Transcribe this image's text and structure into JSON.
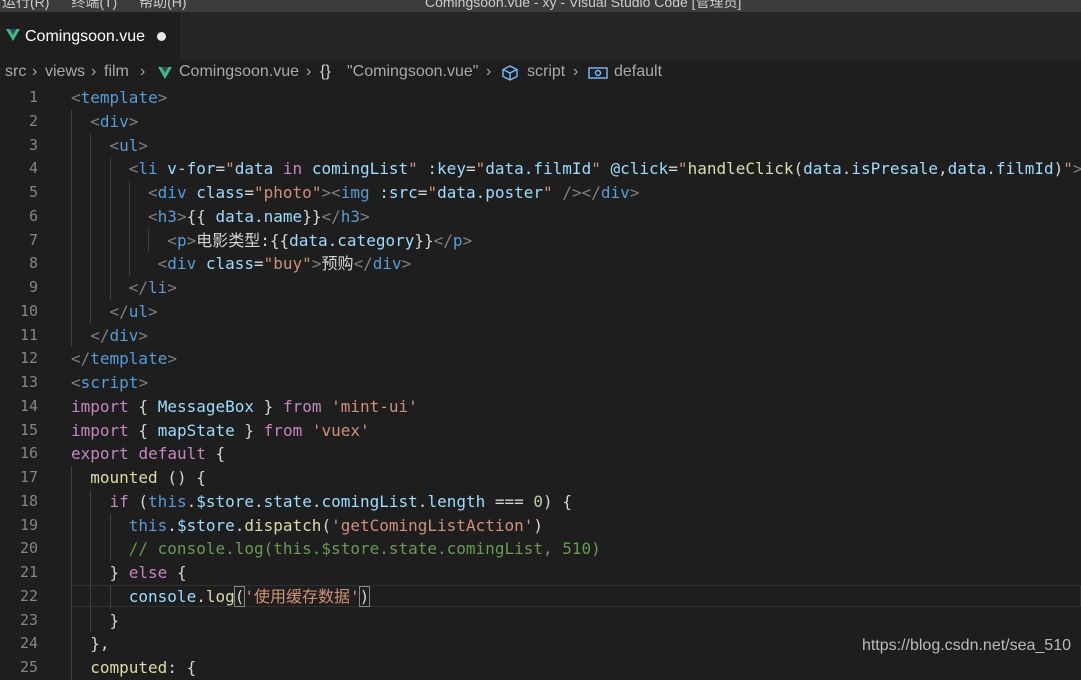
{
  "titlebar": {
    "menu": "运行(R) 终端(T) 帮助(H)",
    "window_title": "Comingsoon.vue - xy - Visual Studio Code [管理员]"
  },
  "tab": {
    "label": "Comingsoon.vue",
    "icon": "vue-icon",
    "modified": true
  },
  "breadcrumb": [
    {
      "text": "src"
    },
    {
      "text": "views"
    },
    {
      "text": "film"
    },
    {
      "text": "Comingsoon.vue",
      "icon": "vue-icon"
    },
    {
      "text": "\"Comingsoon.vue\"",
      "icon": "braces-icon"
    },
    {
      "text": "script",
      "icon": "cube-icon"
    },
    {
      "text": "default",
      "icon": "reference-icon"
    }
  ],
  "editor": {
    "current_line": 22,
    "lines": [
      {
        "n": "1",
        "indent": 0,
        "tokens": [
          [
            "<",
            "punc"
          ],
          [
            "template",
            "tag"
          ],
          [
            ">",
            "punc"
          ]
        ]
      },
      {
        "n": "2",
        "indent": 1,
        "tokens": [
          [
            "<",
            "punc"
          ],
          [
            "div",
            "tag"
          ],
          [
            ">",
            "punc"
          ]
        ]
      },
      {
        "n": "3",
        "indent": 2,
        "tokens": [
          [
            "<",
            "punc"
          ],
          [
            "ul",
            "tag"
          ],
          [
            ">",
            "punc"
          ]
        ]
      },
      {
        "n": "4",
        "indent": 3,
        "tokens": [
          [
            "<",
            "punc"
          ],
          [
            "li",
            "tag"
          ],
          [
            " v-for",
            "attr"
          ],
          [
            "=",
            "text"
          ],
          [
            "\"",
            "str"
          ],
          [
            "data",
            "var"
          ],
          [
            " in ",
            "kw"
          ],
          [
            "comingList",
            "var"
          ],
          [
            "\"",
            "str"
          ],
          [
            " :key",
            "attr"
          ],
          [
            "=",
            "text"
          ],
          [
            "\"",
            "str"
          ],
          [
            "data.filmId",
            "var"
          ],
          [
            "\"",
            "str"
          ],
          [
            " @click",
            "attr"
          ],
          [
            "=",
            "text"
          ],
          [
            "\"",
            "str"
          ],
          [
            "handleClick",
            "fn"
          ],
          [
            "(",
            "text"
          ],
          [
            "data.isPresale",
            "var"
          ],
          [
            ",",
            "text"
          ],
          [
            "data.filmId",
            "var"
          ],
          [
            ")",
            "text"
          ],
          [
            "\"",
            "str"
          ],
          [
            ">",
            "punc"
          ]
        ]
      },
      {
        "n": "5",
        "indent": 4,
        "tokens": [
          [
            "<",
            "punc"
          ],
          [
            "div",
            "tag"
          ],
          [
            " class",
            "attr"
          ],
          [
            "=",
            "text"
          ],
          [
            "\"photo\"",
            "str"
          ],
          [
            "><",
            "punc"
          ],
          [
            "img",
            "tag"
          ],
          [
            " :src",
            "attr"
          ],
          [
            "=",
            "text"
          ],
          [
            "\"",
            "str"
          ],
          [
            "data.poster",
            "var"
          ],
          [
            "\"",
            "str"
          ],
          [
            " ",
            "text"
          ],
          [
            "/></",
            "punc"
          ],
          [
            "div",
            "tag"
          ],
          [
            ">",
            "punc"
          ]
        ]
      },
      {
        "n": "6",
        "indent": 4,
        "tokens": [
          [
            "<",
            "punc"
          ],
          [
            "h3",
            "tag"
          ],
          [
            ">",
            "punc"
          ],
          [
            "{{ ",
            "text"
          ],
          [
            "data.name",
            "var"
          ],
          [
            "}}",
            "text"
          ],
          [
            "</",
            "punc"
          ],
          [
            "h3",
            "tag"
          ],
          [
            ">",
            "punc"
          ]
        ]
      },
      {
        "n": "7",
        "indent": 5,
        "tokens": [
          [
            "<",
            "punc"
          ],
          [
            "p",
            "tag"
          ],
          [
            ">",
            "punc"
          ],
          [
            "电影类型:{{",
            "text"
          ],
          [
            "data.category",
            "var"
          ],
          [
            "}}",
            "text"
          ],
          [
            "</",
            "punc"
          ],
          [
            "p",
            "tag"
          ],
          [
            ">",
            "punc"
          ]
        ]
      },
      {
        "n": "8",
        "indent": 4.5,
        "tokens": [
          [
            "<",
            "punc"
          ],
          [
            "div",
            "tag"
          ],
          [
            " class",
            "attr"
          ],
          [
            "=",
            "text"
          ],
          [
            "\"buy\"",
            "str"
          ],
          [
            ">",
            "punc"
          ],
          [
            "预购",
            "text"
          ],
          [
            "</",
            "punc"
          ],
          [
            "div",
            "tag"
          ],
          [
            ">",
            "punc"
          ]
        ]
      },
      {
        "n": "9",
        "indent": 3,
        "tokens": [
          [
            "</",
            "punc"
          ],
          [
            "li",
            "tag"
          ],
          [
            ">",
            "punc"
          ]
        ]
      },
      {
        "n": "10",
        "indent": 2,
        "tokens": [
          [
            "</",
            "punc"
          ],
          [
            "ul",
            "tag"
          ],
          [
            ">",
            "punc"
          ]
        ]
      },
      {
        "n": "11",
        "indent": 1,
        "tokens": [
          [
            "</",
            "punc"
          ],
          [
            "div",
            "tag"
          ],
          [
            ">",
            "punc"
          ]
        ]
      },
      {
        "n": "12",
        "indent": 0,
        "tokens": [
          [
            "</",
            "punc"
          ],
          [
            "template",
            "tag"
          ],
          [
            ">",
            "punc"
          ]
        ]
      },
      {
        "n": "13",
        "indent": 0,
        "tokens": [
          [
            "<",
            "punc"
          ],
          [
            "script",
            "tag"
          ],
          [
            ">",
            "punc"
          ]
        ]
      },
      {
        "n": "14",
        "indent": 0,
        "tokens": [
          [
            "import",
            "kw"
          ],
          [
            " { ",
            "text"
          ],
          [
            "MessageBox",
            "var"
          ],
          [
            " } ",
            "text"
          ],
          [
            "from",
            "kw"
          ],
          [
            " ",
            "text"
          ],
          [
            "'mint-ui'",
            "str"
          ]
        ]
      },
      {
        "n": "15",
        "indent": 0,
        "tokens": [
          [
            "import",
            "kw"
          ],
          [
            " { ",
            "text"
          ],
          [
            "mapState",
            "var"
          ],
          [
            " } ",
            "text"
          ],
          [
            "from",
            "kw"
          ],
          [
            " ",
            "text"
          ],
          [
            "'vuex'",
            "str"
          ]
        ]
      },
      {
        "n": "16",
        "indent": 0,
        "tokens": [
          [
            "export",
            "kw"
          ],
          [
            " ",
            "text"
          ],
          [
            "default",
            "kw"
          ],
          [
            " {",
            "text"
          ]
        ]
      },
      {
        "n": "17",
        "indent": 1,
        "tokens": [
          [
            "mounted",
            "fn"
          ],
          [
            " () {",
            "text"
          ]
        ]
      },
      {
        "n": "18",
        "indent": 2,
        "tokens": [
          [
            "if",
            "kw"
          ],
          [
            " (",
            "text"
          ],
          [
            "this",
            "this"
          ],
          [
            ".",
            "text"
          ],
          [
            "$store",
            "var"
          ],
          [
            ".",
            "text"
          ],
          [
            "state",
            "var"
          ],
          [
            ".",
            "text"
          ],
          [
            "comingList",
            "var"
          ],
          [
            ".",
            "text"
          ],
          [
            "length",
            "var"
          ],
          [
            " === ",
            "text"
          ],
          [
            "0",
            "num"
          ],
          [
            ") {",
            "text"
          ]
        ]
      },
      {
        "n": "19",
        "indent": 3,
        "tokens": [
          [
            "this",
            "this"
          ],
          [
            ".",
            "text"
          ],
          [
            "$store",
            "var"
          ],
          [
            ".",
            "text"
          ],
          [
            "dispatch",
            "fn"
          ],
          [
            "(",
            "text"
          ],
          [
            "'getComingListAction'",
            "str"
          ],
          [
            ")",
            "text"
          ]
        ]
      },
      {
        "n": "20",
        "indent": 3,
        "tokens": [
          [
            "// console.log(this.$store.state.comingList, 510)",
            "com"
          ]
        ]
      },
      {
        "n": "21",
        "indent": 2,
        "tokens": [
          [
            "} ",
            "text"
          ],
          [
            "else",
            "kw"
          ],
          [
            " {",
            "text"
          ]
        ]
      },
      {
        "n": "22",
        "indent": 3,
        "tokens": [
          [
            "console",
            "var"
          ],
          [
            ".",
            "text"
          ],
          [
            "log",
            "fn"
          ],
          [
            "(",
            "brk"
          ],
          [
            "'使用缓存数据'",
            "str"
          ],
          [
            ")",
            "brk"
          ]
        ]
      },
      {
        "n": "23",
        "indent": 2,
        "tokens": [
          [
            "}",
            "text"
          ]
        ]
      },
      {
        "n": "24",
        "indent": 1,
        "tokens": [
          [
            "},",
            "text"
          ]
        ]
      },
      {
        "n": "25",
        "indent": 1,
        "tokens": [
          [
            "computed",
            "fn"
          ],
          [
            ": {",
            "text"
          ]
        ]
      }
    ]
  },
  "watermark": "https://blog.csdn.net/sea_510",
  "colors": {
    "background": "#1e1e1e",
    "tabbar": "#252526",
    "vue_green": "#41b883",
    "vue_dark": "#35495e"
  }
}
